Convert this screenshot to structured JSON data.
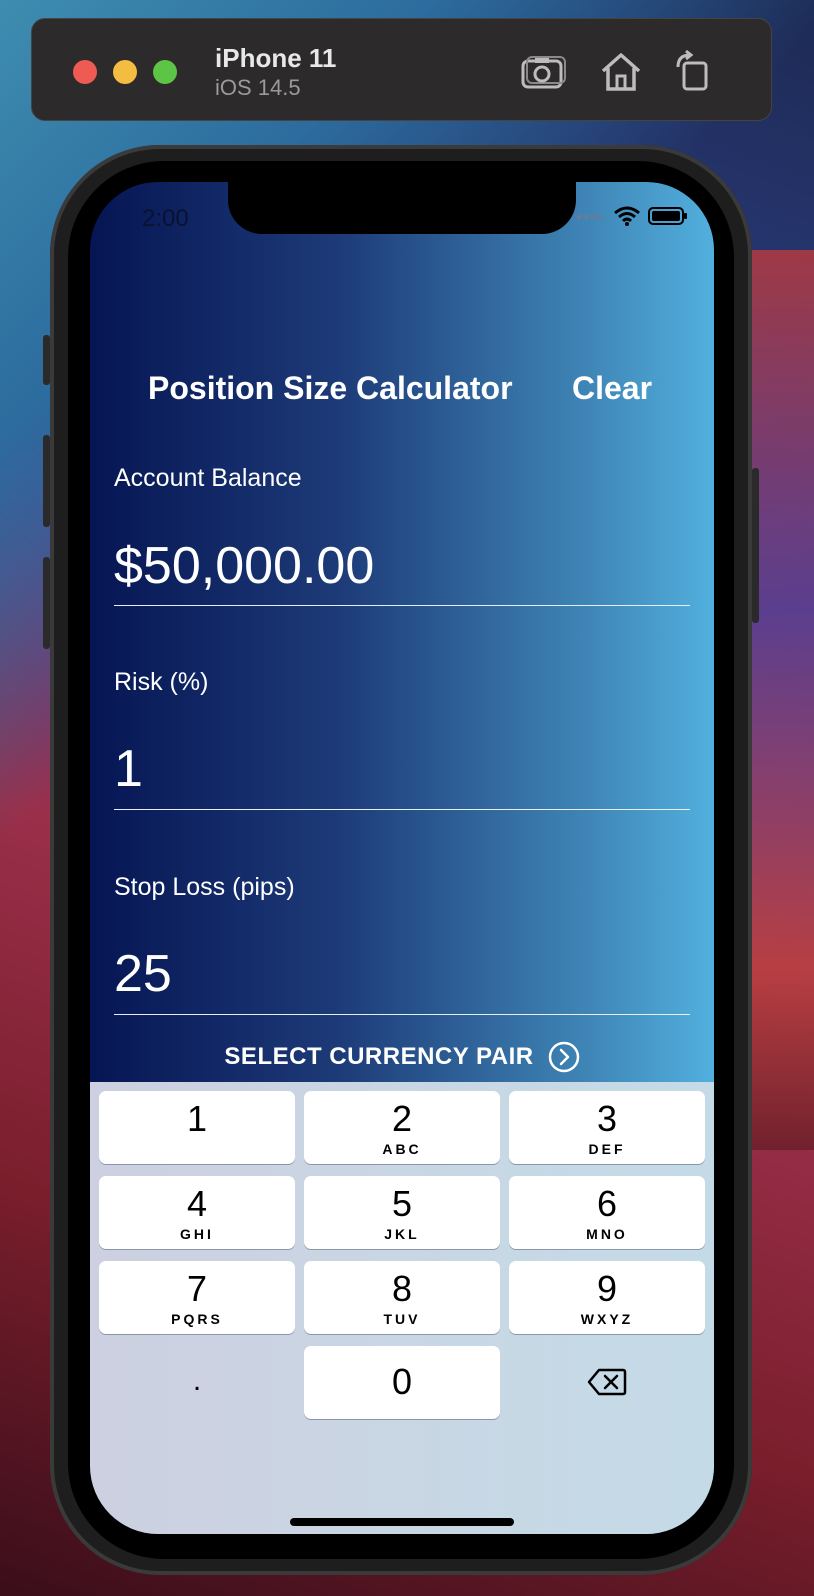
{
  "simulator": {
    "device_name": "iPhone 11",
    "os_version": "iOS 14.5",
    "tools": [
      "screenshot-icon",
      "home-icon",
      "rotate-icon"
    ]
  },
  "status_bar": {
    "time": "2:00"
  },
  "nav": {
    "title": "Position Size Calculator",
    "clear_label": "Clear"
  },
  "fields": {
    "account_balance": {
      "label": "Account Balance",
      "value": "$50,000.00"
    },
    "risk": {
      "label": "Risk (%)",
      "value": "1"
    },
    "stop_loss": {
      "label": "Stop Loss (pips)",
      "value": "25"
    }
  },
  "select_pair": {
    "label": "SELECT CURRENCY PAIR",
    "icon": "chevron-right-circle-icon"
  },
  "keypad": {
    "keys": [
      {
        "digit": "1",
        "letters": ""
      },
      {
        "digit": "2",
        "letters": "ABC"
      },
      {
        "digit": "3",
        "letters": "DEF"
      },
      {
        "digit": "4",
        "letters": "GHI"
      },
      {
        "digit": "5",
        "letters": "JKL"
      },
      {
        "digit": "6",
        "letters": "MNO"
      },
      {
        "digit": "7",
        "letters": "PQRS"
      },
      {
        "digit": "8",
        "letters": "TUV"
      },
      {
        "digit": "9",
        "letters": "WXYZ"
      },
      {
        "digit": "0",
        "letters": ""
      }
    ],
    "decimal": ".",
    "delete_icon": "backspace-icon"
  },
  "colors": {
    "accent": "#52b0de",
    "background_dark": "#061553"
  }
}
